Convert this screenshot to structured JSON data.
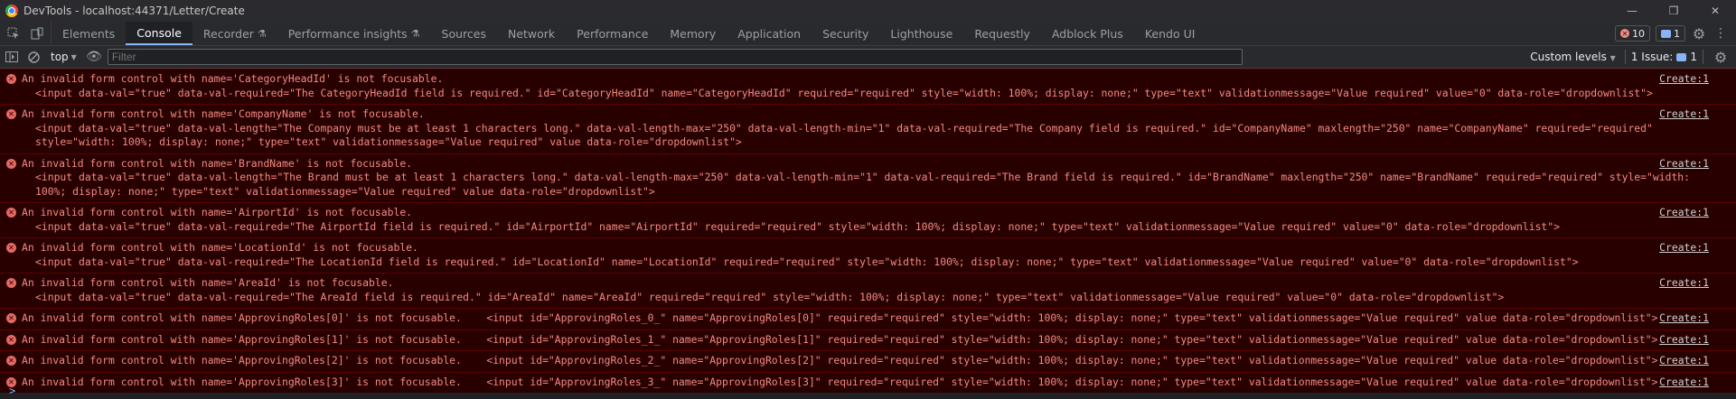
{
  "window": {
    "title": "DevTools - localhost:44371/Letter/Create"
  },
  "tabs": [
    {
      "label": "Elements"
    },
    {
      "label": "Console",
      "active": true
    },
    {
      "label": "Recorder",
      "flask": true
    },
    {
      "label": "Performance insights",
      "flask": true
    },
    {
      "label": "Sources"
    },
    {
      "label": "Network"
    },
    {
      "label": "Performance"
    },
    {
      "label": "Memory"
    },
    {
      "label": "Application"
    },
    {
      "label": "Security"
    },
    {
      "label": "Lighthouse"
    },
    {
      "label": "Requestly"
    },
    {
      "label": "Adblock Plus"
    },
    {
      "label": "Kendo UI"
    }
  ],
  "status": {
    "error_count": "10",
    "message_count": "1"
  },
  "toolbar": {
    "context": "top",
    "filter_placeholder": "Filter",
    "levels": "Custom levels",
    "issues_label": "1 Issue:",
    "issues_count": "1"
  },
  "console": {
    "messages": [
      {
        "text": "An invalid form control with name='CategoryHeadId' is not focusable.",
        "detail": "<input data-val=\"true\" data-val-required=\"The CategoryHeadId field is required.\" id=\"CategoryHeadId\" name=\"CategoryHeadId\" required=\"required\" style=\"width: 100%; display: none;\" type=\"text\" validationmessage=\"Value required\" value=\"0\" data-role=\"dropdownlist\">",
        "source": "Create:1",
        "inline": false
      },
      {
        "text": "An invalid form control with name='CompanyName' is not focusable.",
        "detail": "<input data-val=\"true\" data-val-length=\"The Company must be at least 1 characters long.\" data-val-length-max=\"250\" data-val-length-min=\"1\" data-val-required=\"The Company field is required.\" id=\"CompanyName\" maxlength=\"250\" name=\"CompanyName\" required=\"required\" style=\"width: 100%; display: none;\" type=\"text\" validationmessage=\"Value required\" value data-role=\"dropdownlist\">",
        "source": "Create:1",
        "inline": false
      },
      {
        "text": "An invalid form control with name='BrandName' is not focusable.",
        "detail": "<input data-val=\"true\" data-val-length=\"The Brand must be at least 1 characters long.\" data-val-length-max=\"250\" data-val-length-min=\"1\" data-val-required=\"The Brand field is required.\" id=\"BrandName\" maxlength=\"250\" name=\"BrandName\" required=\"required\" style=\"width: 100%; display: none;\" type=\"text\" validationmessage=\"Value required\" value data-role=\"dropdownlist\">",
        "source": "Create:1",
        "inline": false
      },
      {
        "text": "An invalid form control with name='AirportId' is not focusable.",
        "detail": "<input data-val=\"true\" data-val-required=\"The AirportId field is required.\" id=\"AirportId\" name=\"AirportId\" required=\"required\" style=\"width: 100%; display: none;\" type=\"text\" validationmessage=\"Value required\" value=\"0\" data-role=\"dropdownlist\">",
        "source": "Create:1",
        "inline": false
      },
      {
        "text": "An invalid form control with name='LocationId' is not focusable.",
        "detail": "<input data-val=\"true\" data-val-required=\"The LocationId field is required.\" id=\"LocationId\" name=\"LocationId\" required=\"required\" style=\"width: 100%; display: none;\" type=\"text\" validationmessage=\"Value required\" value=\"0\" data-role=\"dropdownlist\">",
        "source": "Create:1",
        "inline": false
      },
      {
        "text": "An invalid form control with name='AreaId' is not focusable.",
        "detail": "<input data-val=\"true\" data-val-required=\"The AreaId field is required.\" id=\"AreaId\" name=\"AreaId\" required=\"required\" style=\"width: 100%; display: none;\" type=\"text\" validationmessage=\"Value required\" value=\"0\" data-role=\"dropdownlist\">",
        "source": "Create:1",
        "inline": false
      },
      {
        "text": "An invalid form control with name='ApprovingRoles[0]' is not focusable.",
        "detail": "<input id=\"ApprovingRoles_0_\" name=\"ApprovingRoles[0]\" required=\"required\" style=\"width: 100%; display: none;\" type=\"text\" validationmessage=\"Value required\" value data-role=\"dropdownlist\">",
        "source": "Create:1",
        "inline": true
      },
      {
        "text": "An invalid form control with name='ApprovingRoles[1]' is not focusable.",
        "detail": "<input id=\"ApprovingRoles_1_\" name=\"ApprovingRoles[1]\" required=\"required\" style=\"width: 100%; display: none;\" type=\"text\" validationmessage=\"Value required\" value data-role=\"dropdownlist\">",
        "source": "Create:1",
        "inline": true
      },
      {
        "text": "An invalid form control with name='ApprovingRoles[2]' is not focusable.",
        "detail": "<input id=\"ApprovingRoles_2_\" name=\"ApprovingRoles[2]\" required=\"required\" style=\"width: 100%; display: none;\" type=\"text\" validationmessage=\"Value required\" value data-role=\"dropdownlist\">",
        "source": "Create:1",
        "inline": true
      },
      {
        "text": "An invalid form control with name='ApprovingRoles[3]' is not focusable.",
        "detail": "<input id=\"ApprovingRoles_3_\" name=\"ApprovingRoles[3]\" required=\"required\" style=\"width: 100%; display: none;\" type=\"text\" validationmessage=\"Value required\" value data-role=\"dropdownlist\">",
        "source": "Create:1",
        "inline": true
      }
    ],
    "prompt": ">"
  }
}
